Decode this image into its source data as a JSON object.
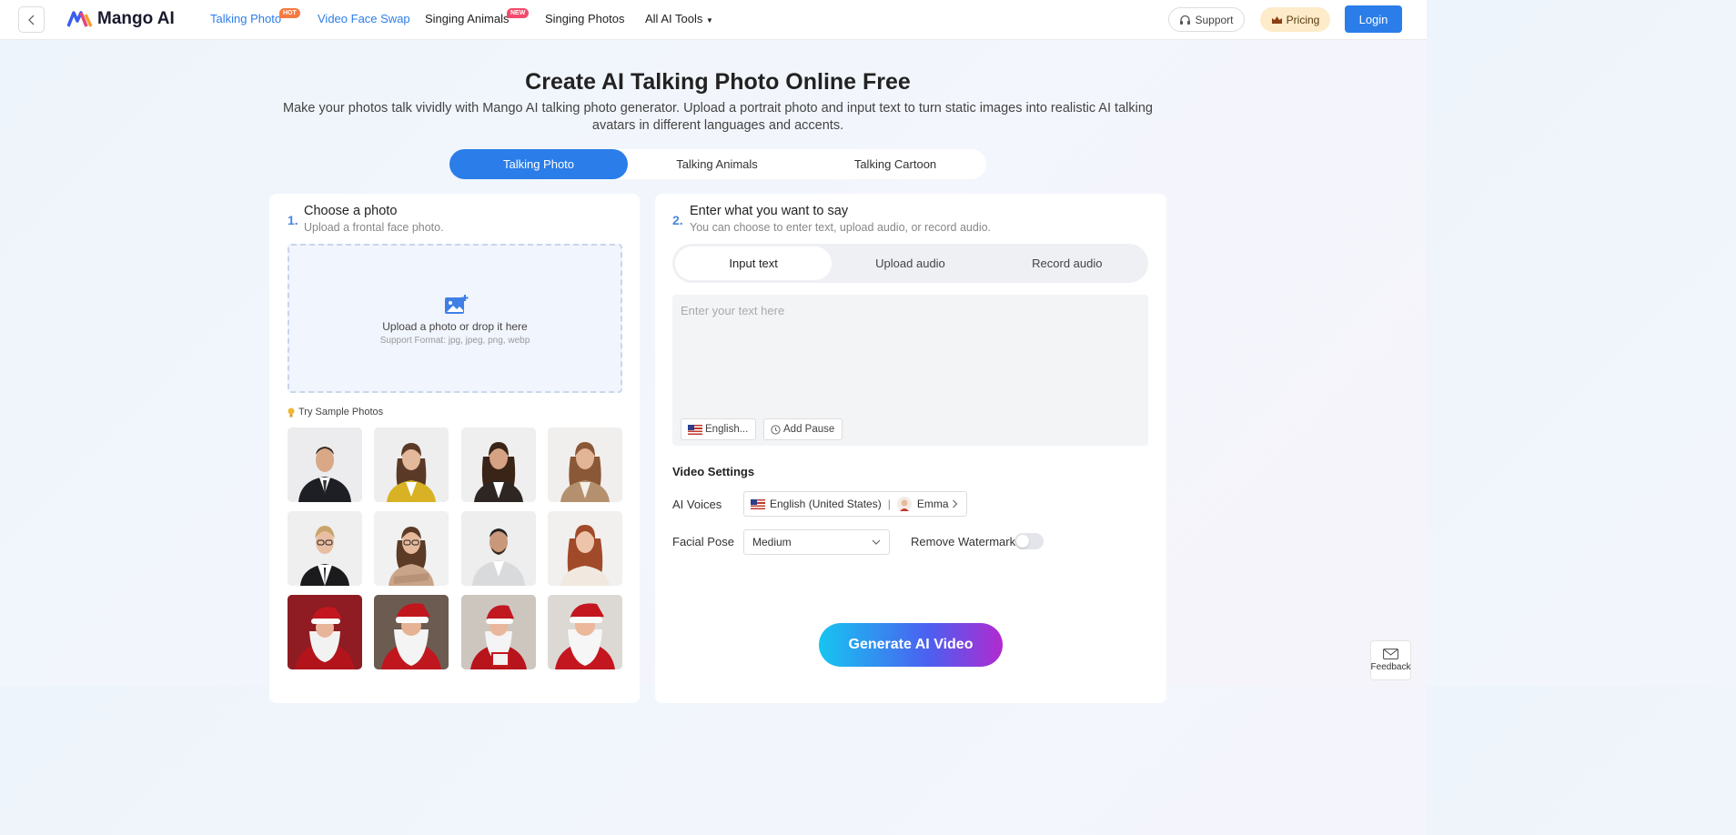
{
  "nav": {
    "logo_text": "Mango AI",
    "links": [
      {
        "label": "Talking Photo",
        "badge": "HOT"
      },
      {
        "label": "Video Face Swap"
      },
      {
        "label": "Singing Animals",
        "badge": "NEW"
      },
      {
        "label": "Singing Photos"
      },
      {
        "label": "All AI Tools"
      }
    ],
    "support_label": "Support",
    "pricing_label": "Pricing",
    "login_label": "Login"
  },
  "hero": {
    "title": "Create AI Talking Photo Online Free",
    "subtitle": "Make your photos talk vividly with Mango AI talking photo generator. Upload a portrait photo and input text to turn static images into realistic AI talking avatars in different languages and accents."
  },
  "main_tabs": [
    "Talking Photo",
    "Talking Animals",
    "Talking Cartoon"
  ],
  "step1": {
    "number": "1.",
    "title": "Choose a photo",
    "desc": "Upload a frontal face photo.",
    "upload_label": "Upload a photo or drop it here",
    "upload_hint": "Support Format: jpg, jpeg, png, webp",
    "sample_label": "Try Sample Photos"
  },
  "step2": {
    "number": "2.",
    "title": "Enter what you want to say",
    "desc": "You can choose to enter text, upload audio, or record audio.",
    "tabs": [
      "Input text",
      "Upload audio",
      "Record audio"
    ],
    "placeholder": "Enter your text here",
    "lang_chip": "English...",
    "pause_chip": "Add Pause"
  },
  "video_settings": {
    "title": "Video Settings",
    "voices_label": "AI Voices",
    "voice_language": "English (United States)",
    "voice_name": "Emma",
    "pose_label": "Facial Pose",
    "pose_value": "Medium",
    "watermark_label": "Remove Watermark",
    "watermark_on": false
  },
  "generate_label": "Generate AI Video",
  "feedback_label": "Feedback",
  "colors": {
    "accent": "#2b7de9",
    "hot_badge": "#f47a42",
    "new_badge": "#f34a6c",
    "pricing_bg": "#fdebc9"
  }
}
